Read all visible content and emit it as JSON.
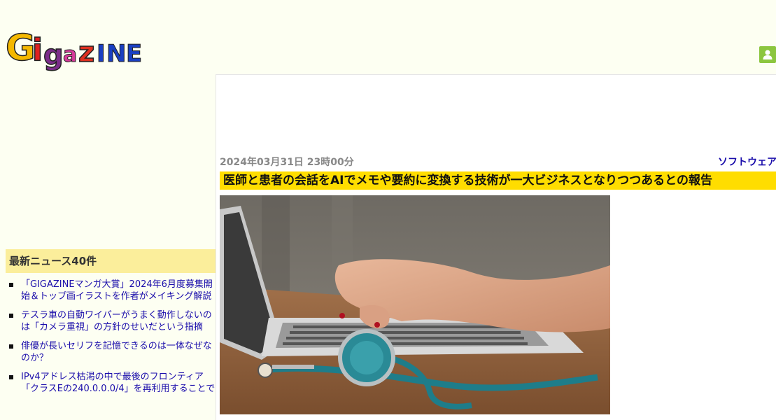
{
  "site": {
    "logo_text": "GIGAZINE"
  },
  "header": {
    "user_icon": "user-icon"
  },
  "sidebar": {
    "heading": "最新ニュース40件",
    "items": [
      {
        "label": "「GIGAZINEマンガ大賞」2024年6月度募集開始＆トップ画イラストを作者がメイキング解説"
      },
      {
        "label": "テスラ車の自動ワイパーがうまく動作しないのは「カメラ重視」の方針のせいだという指摘"
      },
      {
        "label": "俳優が長いセリフを記憶できるのは一体なぜなのか？"
      },
      {
        "label": "IPv4アドレス枯渇の中で最後のフロンティア「クラスEの240.0.0.0/4」を再利用することで"
      }
    ]
  },
  "article": {
    "date": "2024年03月31日 23時00分",
    "category": "ソフトウェア",
    "title": "医師と患者の会話をAIでメモや要約に変換する技術が一大ビジネスとなりつつあるとの報告"
  },
  "colors": {
    "page_bg": "#fdfff2",
    "title_highlight": "#ffdd00",
    "sidebar_heading_bg": "#fbee9b",
    "link": "#1a0dab",
    "user_icon_bg": "#8cc63f"
  }
}
